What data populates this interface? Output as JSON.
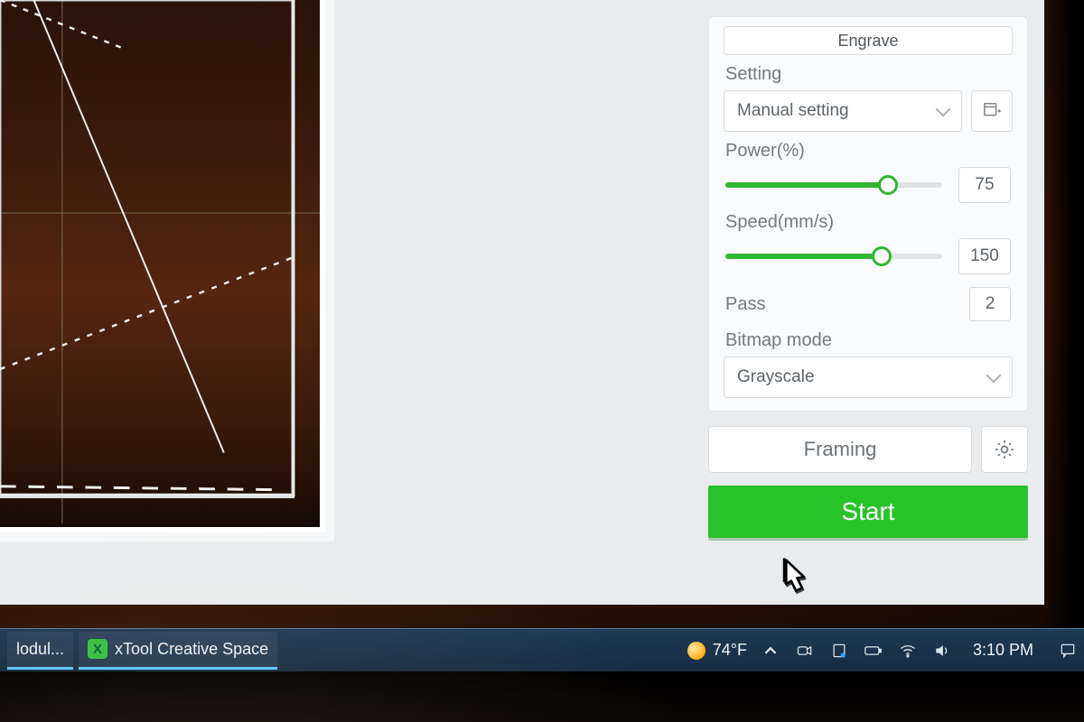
{
  "panel": {
    "mode_label": "Engrave",
    "setting_label": "Setting",
    "setting_select": "Manual setting",
    "power_label": "Power(%)",
    "power_value": "75",
    "power_pct": 75,
    "speed_label": "Speed(mm/s)",
    "speed_value": "150",
    "speed_pct": 72,
    "pass_label": "Pass",
    "pass_value": "2",
    "bitmap_label": "Bitmap mode",
    "bitmap_select": "Grayscale",
    "framing_label": "Framing",
    "start_label": "Start"
  },
  "taskbar": {
    "app1_label": "lodul...",
    "app2_label": "xTool Creative Space",
    "weather_temp": "74°F",
    "clock": "3:10 PM"
  },
  "colors": {
    "accent_green": "#28c328",
    "slider_green": "#2fb72f"
  }
}
